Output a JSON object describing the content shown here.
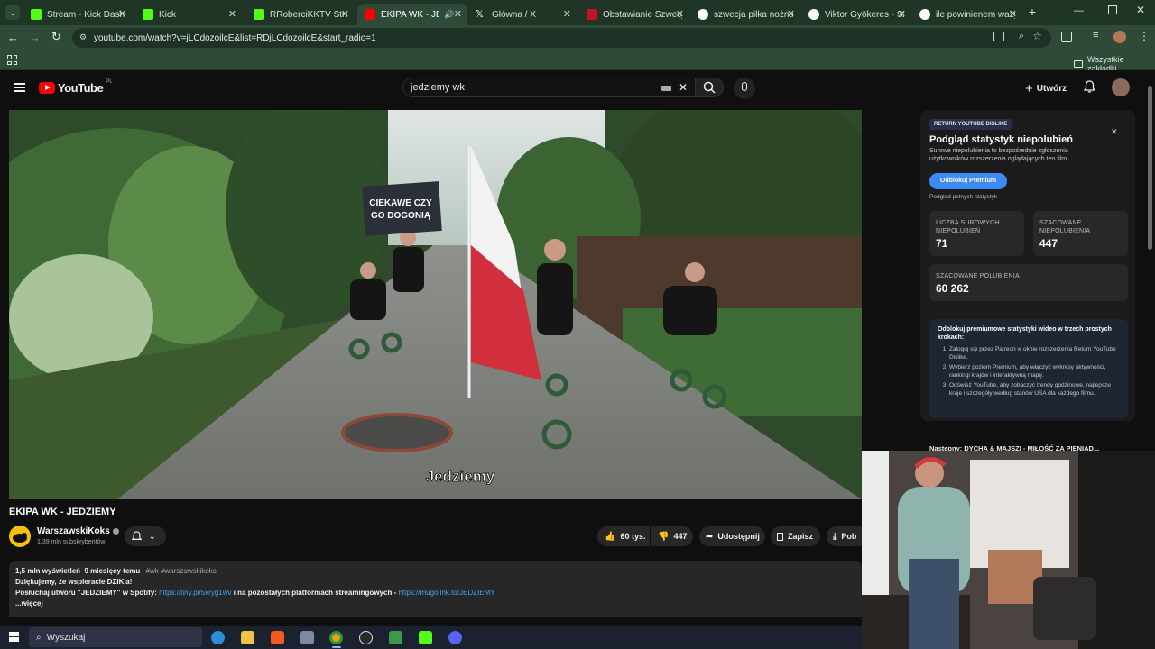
{
  "browser": {
    "tabs": [
      {
        "label": "Stream - Kick Dashbo",
        "favicon_color": "#53fc18"
      },
      {
        "label": "Kick",
        "favicon_color": "#53fc18"
      },
      {
        "label": "RRoberciKKTV Stream",
        "favicon_color": "#53fc18"
      },
      {
        "label": "EKIPA WK - JEDZ",
        "favicon_color": "#ff0000",
        "active": true
      },
      {
        "label": "Główna / X",
        "favicon_color": "#000000"
      },
      {
        "label": "Obstawianie Szwecja",
        "favicon_color": "#c8102e"
      },
      {
        "label": "szwecja piłka nożna",
        "favicon_color": "#ffffff"
      },
      {
        "label": "Viktor Gyökeres - Sze",
        "favicon_color": "#ffffff"
      },
      {
        "label": "ile powinienem ważyć",
        "favicon_color": "#ffffff"
      }
    ],
    "url": "youtube.com/watch?v=jLCdozoilcE&list=RDjLCdozoilcE&start_radio=1",
    "bookmarks_label": "Wszystkie zakładki"
  },
  "youtube": {
    "logo_text": "YouTube",
    "logo_region": "PL",
    "search_value": "jedziemy wk",
    "create_label": "Utwórz",
    "video": {
      "sign_text_line1": "CIEKAWE CZY",
      "sign_text_line2": "GO DOGONIĄ",
      "caption": "Jedziemy"
    },
    "title": "EKIPA WK - JEDZIEMY",
    "channel": {
      "name": "WarszawskiKoks",
      "subscribers": "1,39 mln subskrybentów"
    },
    "actions": {
      "likes": "60 tys.",
      "dislikes": "447",
      "share": "Udostępnij",
      "save": "Zapisz",
      "download": "Pob"
    },
    "description": {
      "meta": "1,5 mln wyświetleń  9 miesięcy temu",
      "tags": "#wk #warszawskikoks",
      "line1": "Dziękujemy, że wspieracie DZIK'a!",
      "line2_prefix": "Posłuchaj utworu \"JEDZIEMY\" w Spotify:",
      "spotify_link": "https://tiny.pl/5xryg1wv",
      "line2_middle": "i na pozostałych platformach streamingowych -",
      "other_link": "https://mugo.lnk.to/JEDZIEMY",
      "more": "...więcej"
    },
    "next_up": "Następny: DYCHA & MAJSZI - MIŁOŚĆ ZA PIENIĄD..."
  },
  "rydpanel": {
    "badge": "RETURN YOUTUBE DISLIKE",
    "title": "Podgląd statystyk niepolubień",
    "subtitle": "Surowe niepolubienia to bezpośrednie zgłoszenia użytkowników rozszerzenia oglądających ten film.",
    "unlock_button": "Odblokuj Premium",
    "full_stats_label": "Podgląd pełnych statystyk",
    "stats": [
      {
        "label": "LICZBA SUROWYCH NIEPOLUBIEŃ",
        "value": "71"
      },
      {
        "label": "SZACOWANE NIEPOLUBIENIA",
        "value": "447"
      },
      {
        "label": "SZACOWANE POLUBIENIA",
        "value": "60 262"
      }
    ],
    "promo_title": "Odblokuj premiumowe statystyki wideo w trzech prostych krokach:",
    "promo_steps": [
      "Zaloguj się przez Patreon w oknie rozszerzenia Return YouTube Dislike.",
      "Wybierz poziom Premium, aby włączyć wykresy aktywności, rankingi krajów i interaktywną mapę.",
      "Odśwież YouTube, aby zobaczyć trendy godzinowe, najlepsze kraje i szczegóły według stanów USA dla każdego filmu."
    ]
  },
  "taskbar": {
    "search_placeholder": "Wyszukaj"
  }
}
